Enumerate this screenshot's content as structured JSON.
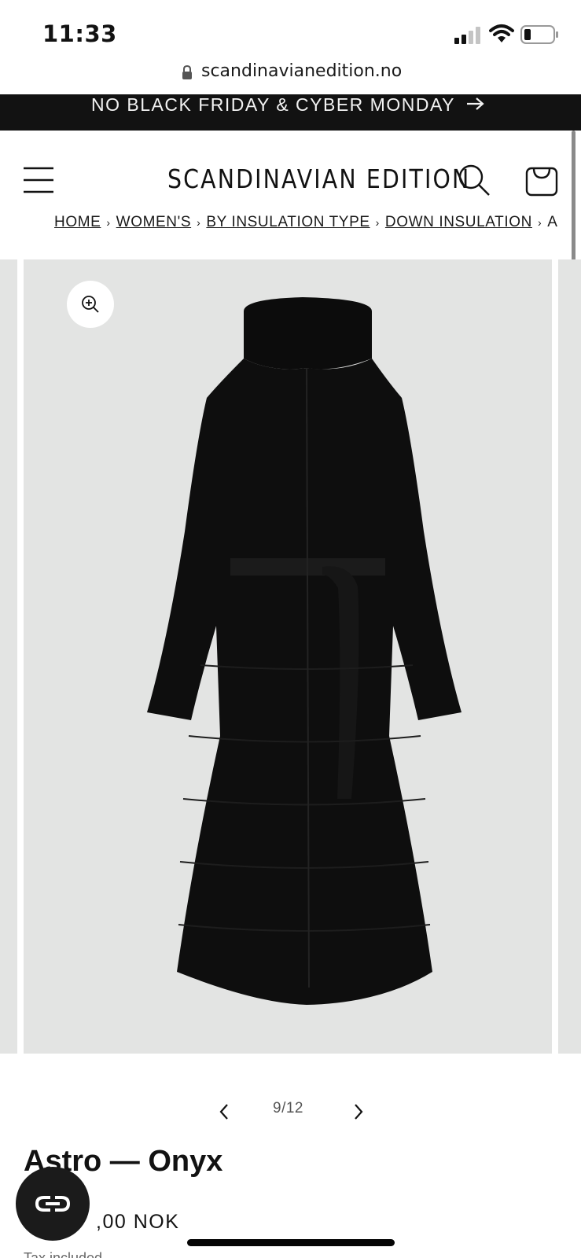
{
  "status_bar": {
    "time": "11:33",
    "signal_icon": "cellular-signal-icon",
    "wifi_icon": "wifi-icon",
    "battery_icon": "battery-low-icon"
  },
  "browser": {
    "url": "scandinavianedition.no",
    "lock_icon": "lock-icon"
  },
  "announcement": {
    "text": "NO BLACK FRIDAY & CYBER MONDAY",
    "arrow_icon": "arrow-right-icon"
  },
  "header": {
    "logo": "SCANDINAVIAN EDITION",
    "menu_icon": "hamburger-menu-icon",
    "search_icon": "search-icon",
    "cart_icon": "shopping-bag-icon"
  },
  "breadcrumb": {
    "items": [
      "HOME",
      "WOMEN'S",
      "BY INSULATION TYPE",
      "DOWN INSULATION"
    ],
    "separator": "›",
    "truncated_next": "A"
  },
  "gallery": {
    "current": "9/12",
    "zoom_icon": "zoom-in-icon",
    "prev_icon": "chevron-left-icon",
    "next_icon": "chevron-right-icon",
    "image_description_icon": "black-long-down-coat-image"
  },
  "product": {
    "title": "Astro — Onyx",
    "price": ",00 NOK",
    "tax_note": "Tax included"
  },
  "chat": {
    "icon": "chat-widget-icon"
  },
  "colors": {
    "announcement_bg": "#121212",
    "gallery_bg": "#e3e4e3",
    "text": "#121212"
  }
}
